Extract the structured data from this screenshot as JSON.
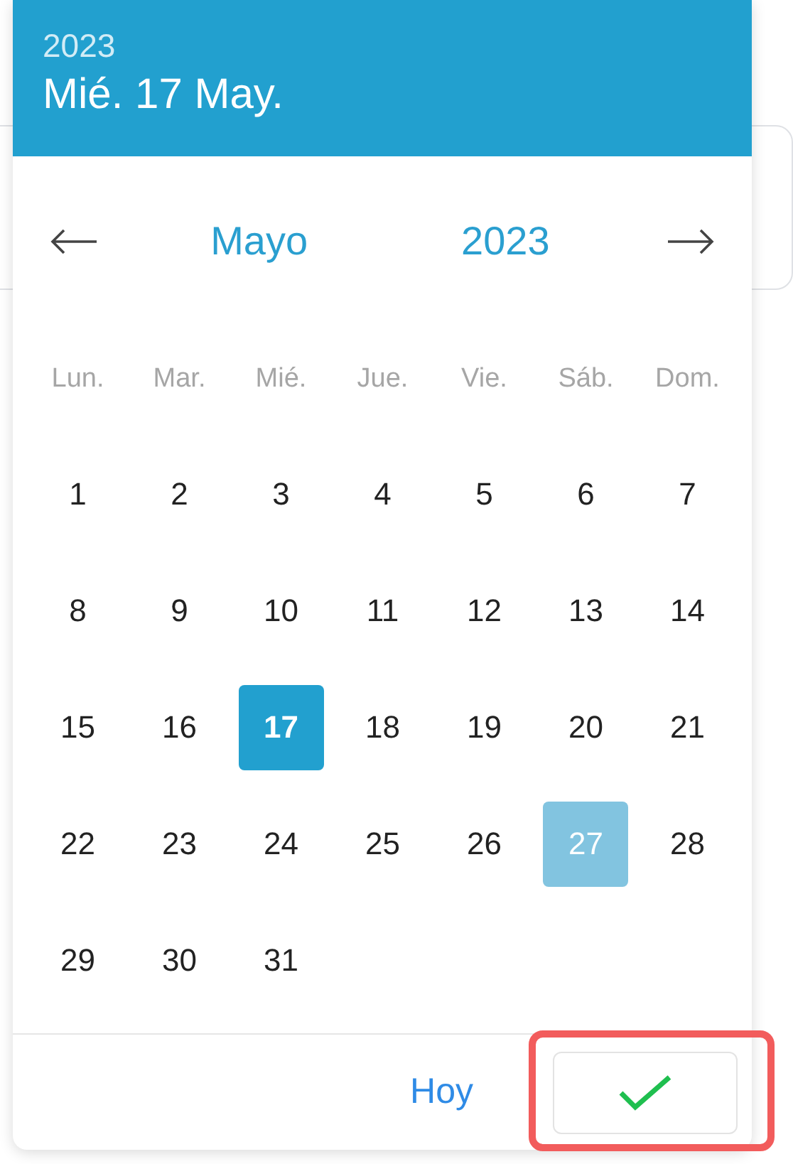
{
  "header": {
    "year": "2023",
    "date": "Mié. 17 May."
  },
  "navigation": {
    "month": "Mayo",
    "year": "2023"
  },
  "weekdays": [
    "Lun.",
    "Mar.",
    "Mié.",
    "Jue.",
    "Vie.",
    "Sáb.",
    "Dom."
  ],
  "weeks": [
    [
      {
        "day": "1",
        "selected": false,
        "today": false
      },
      {
        "day": "2",
        "selected": false,
        "today": false
      },
      {
        "day": "3",
        "selected": false,
        "today": false
      },
      {
        "day": "4",
        "selected": false,
        "today": false
      },
      {
        "day": "5",
        "selected": false,
        "today": false
      },
      {
        "day": "6",
        "selected": false,
        "today": false
      },
      {
        "day": "7",
        "selected": false,
        "today": false
      }
    ],
    [
      {
        "day": "8",
        "selected": false,
        "today": false
      },
      {
        "day": "9",
        "selected": false,
        "today": false
      },
      {
        "day": "10",
        "selected": false,
        "today": false
      },
      {
        "day": "11",
        "selected": false,
        "today": false
      },
      {
        "day": "12",
        "selected": false,
        "today": false
      },
      {
        "day": "13",
        "selected": false,
        "today": false
      },
      {
        "day": "14",
        "selected": false,
        "today": false
      }
    ],
    [
      {
        "day": "15",
        "selected": false,
        "today": false
      },
      {
        "day": "16",
        "selected": false,
        "today": false
      },
      {
        "day": "17",
        "selected": true,
        "today": false
      },
      {
        "day": "18",
        "selected": false,
        "today": false
      },
      {
        "day": "19",
        "selected": false,
        "today": false
      },
      {
        "day": "20",
        "selected": false,
        "today": false
      },
      {
        "day": "21",
        "selected": false,
        "today": false
      }
    ],
    [
      {
        "day": "22",
        "selected": false,
        "today": false
      },
      {
        "day": "23",
        "selected": false,
        "today": false
      },
      {
        "day": "24",
        "selected": false,
        "today": false
      },
      {
        "day": "25",
        "selected": false,
        "today": false
      },
      {
        "day": "26",
        "selected": false,
        "today": false
      },
      {
        "day": "27",
        "selected": false,
        "today": true
      },
      {
        "day": "28",
        "selected": false,
        "today": false
      }
    ],
    [
      {
        "day": "29",
        "selected": false,
        "today": false
      },
      {
        "day": "30",
        "selected": false,
        "today": false
      },
      {
        "day": "31",
        "selected": false,
        "today": false
      }
    ]
  ],
  "footer": {
    "today_button": "Hoy",
    "confirm_button": {
      "highlighted": true
    }
  }
}
